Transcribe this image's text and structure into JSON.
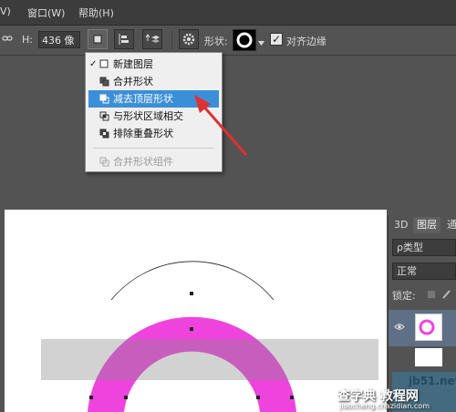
{
  "menubar": {
    "items": [
      "V)",
      "窗口(W)",
      "帮助(H)"
    ]
  },
  "options": {
    "h_label": "H:",
    "h_value": "436 像",
    "shape_label": "形状:",
    "align_label": "对齐边缘",
    "align_checked": true
  },
  "dropdown": {
    "items": [
      {
        "label": "新建图层",
        "checked": true,
        "selected": false,
        "disabled": false,
        "icon": "new-layer-icon"
      },
      {
        "label": "合并形状",
        "checked": false,
        "selected": false,
        "disabled": false,
        "icon": "combine-shapes-icon"
      },
      {
        "label": "减去顶层形状",
        "checked": false,
        "selected": true,
        "disabled": false,
        "icon": "subtract-front-shape-icon"
      },
      {
        "label": "与形状区域相交",
        "checked": false,
        "selected": false,
        "disabled": false,
        "icon": "intersect-shape-icon"
      },
      {
        "label": "排除重叠形状",
        "checked": false,
        "selected": false,
        "disabled": false,
        "icon": "exclude-overlap-icon"
      },
      {
        "label": "合并形状组件",
        "checked": false,
        "selected": false,
        "disabled": true,
        "icon": "merge-components-icon"
      }
    ]
  },
  "layers_panel": {
    "tabs": [
      "3D",
      "图层",
      "通"
    ],
    "filter_label": "ρ类型",
    "blend_mode": "正常",
    "lock_label": "锁定:"
  },
  "watermarks": {
    "site": "jb51.net",
    "brand": "查字典 教程网",
    "url": "jiaocheng.chazidian.com"
  },
  "colors": {
    "ring": "#ee44dd",
    "selection": "#3b8fd9",
    "arrow": "#e03030"
  }
}
